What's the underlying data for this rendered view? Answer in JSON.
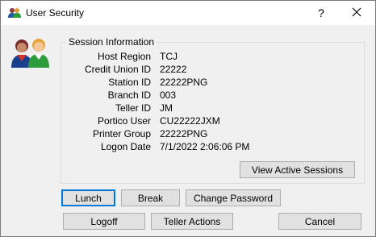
{
  "window": {
    "title": "User Security",
    "help_label": "?",
    "close_icon": "close-icon",
    "title_icon": "user-group-icon"
  },
  "session": {
    "group_title": "Session Information",
    "fields": [
      {
        "label": "Host Region",
        "value": "TCJ"
      },
      {
        "label": "Credit Union ID",
        "value": "22222"
      },
      {
        "label": "Station ID",
        "value": "22222PNG"
      },
      {
        "label": "Branch ID",
        "value": "003"
      },
      {
        "label": "Teller ID",
        "value": "JM"
      },
      {
        "label": "Portico User",
        "value": "CU22222JXM"
      },
      {
        "label": "Printer Group",
        "value": "22222PNG"
      },
      {
        "label": "Logon Date",
        "value": "7/1/2022 2:06:06 PM"
      }
    ],
    "view_sessions_label": "View Active Sessions"
  },
  "buttons": {
    "lunch": "Lunch",
    "break": "Break",
    "change_password": "Change Password",
    "logoff": "Logoff",
    "teller_actions": "Teller Actions",
    "cancel": "Cancel"
  },
  "colors": {
    "accent": "#0078d7",
    "button_face": "#e1e1e1",
    "window_bg": "#f0f0f0"
  }
}
